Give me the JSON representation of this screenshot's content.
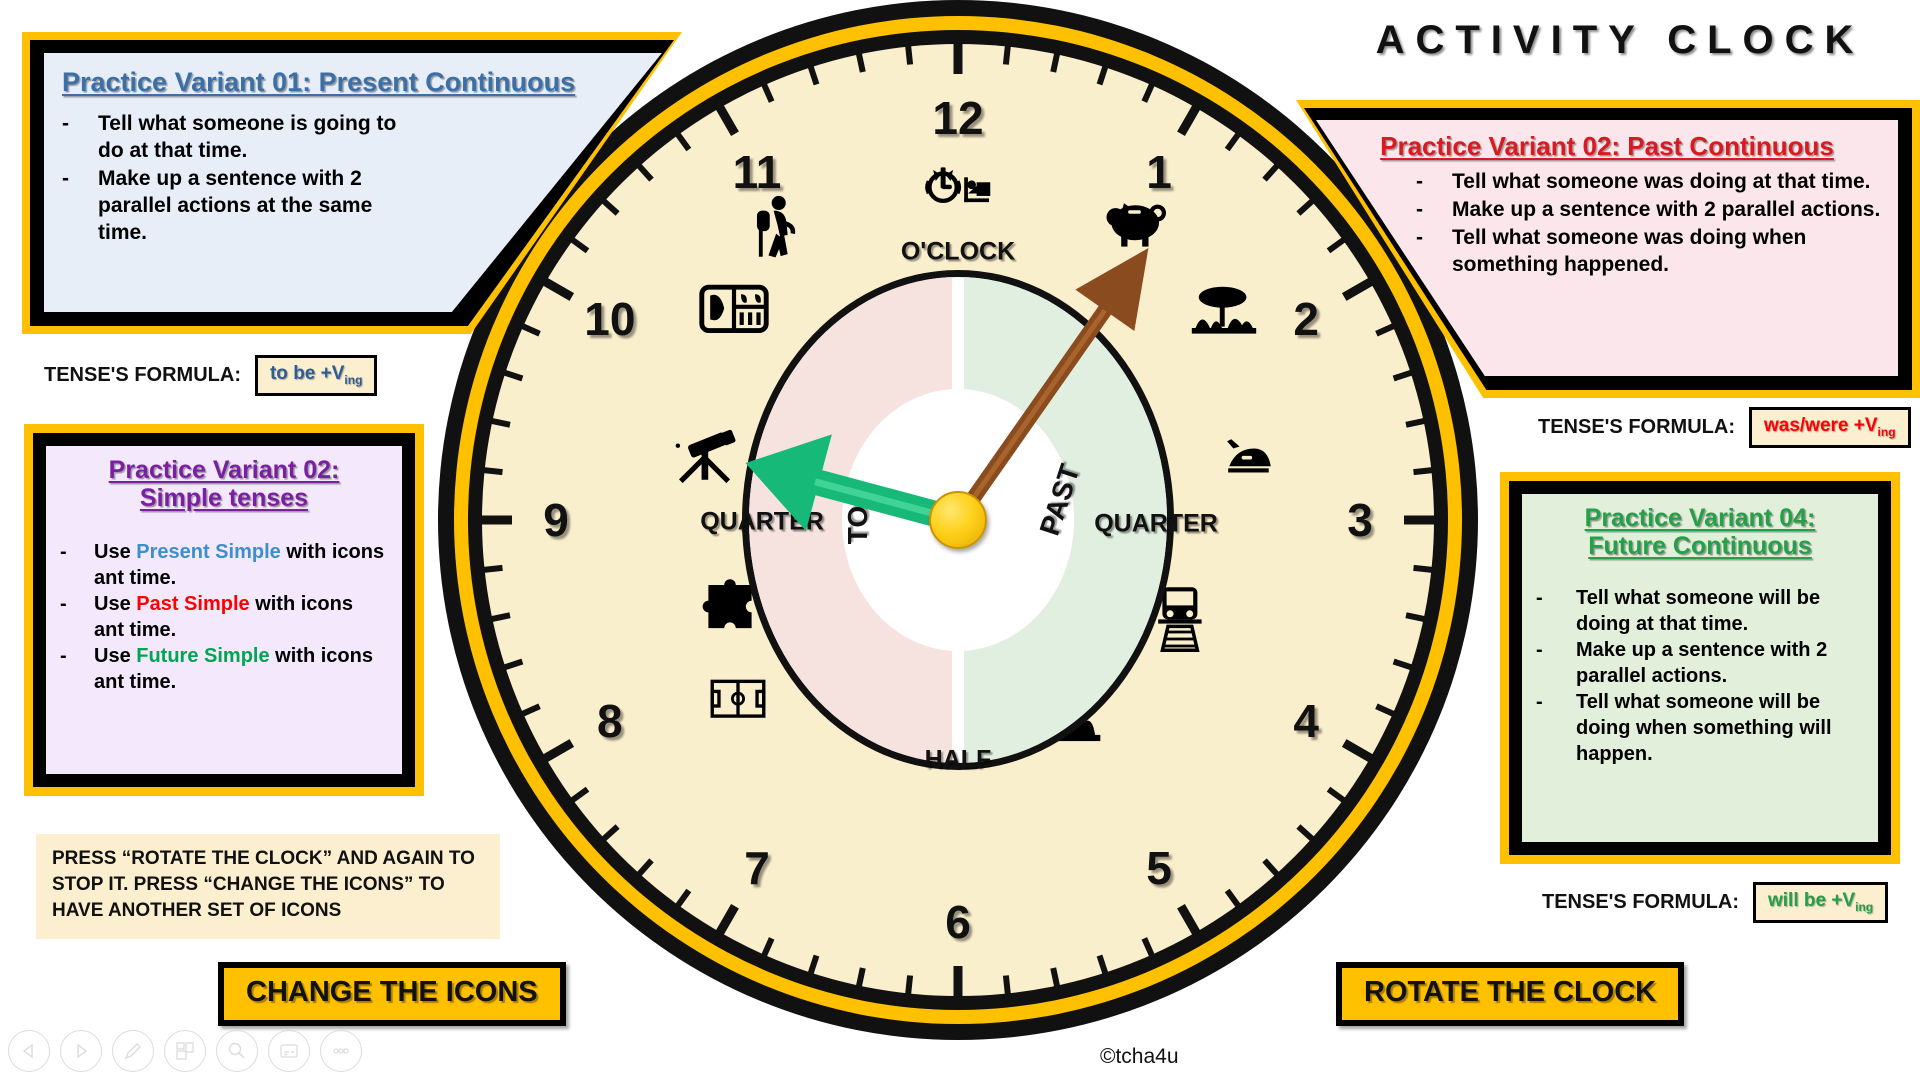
{
  "title": "ACTIVITY CLOCK",
  "copyright": "©tcha4u",
  "boxes": {
    "box1": {
      "heading": "Practice Variant 01: Present Continuous",
      "bullets": [
        "Tell what someone is going to do at that time.",
        "Make up a sentence with 2 parallel actions at the same time."
      ],
      "color": "#3B6FA8",
      "bg": "#E8EEF7"
    },
    "box2": {
      "heading_line1": "Practice Variant 02:",
      "heading_line2": "Simple tenses",
      "bullets": [
        {
          "pre": "Use ",
          "hl": "Present Simple",
          "post": " with icons ant time.",
          "hl_color": "#3B8FCB"
        },
        {
          "pre": "Use ",
          "hl": "Past Simple",
          "post": " with icons ant time.",
          "hl_color": "#FF0000"
        },
        {
          "pre": "Use ",
          "hl": "Future Simple",
          "post": " with icons ant time.",
          "hl_color": "#00A651"
        }
      ],
      "color": "#7B1FA2",
      "bg": "#F4E8FC"
    },
    "box3": {
      "heading": "Practice Variant 02: Past Continuous",
      "bullets": [
        "Tell what someone was doing at that time.",
        "Make up a sentence with 2 parallel actions.",
        "Tell what someone was doing when something happened."
      ],
      "color": "#D91A20",
      "bg": "#FBE7EB"
    },
    "box4": {
      "heading_line1": "Practice Variant 04:",
      "heading_line2": "Future Continuous",
      "bullets": [
        "Tell what someone will be doing at that time.",
        "Make up a sentence with 2 parallel actions.",
        "Tell what someone will be doing when something will happen."
      ],
      "color": "#23A048",
      "bg": "#E2EFDA"
    }
  },
  "formulas": [
    {
      "label": "TENSE'S FORMULA:",
      "value_main": "to be +V",
      "value_sub": "ing",
      "color": "#2E5C96"
    },
    {
      "label": "TENSE'S FORMULA:",
      "value_main": "was/were +V",
      "value_sub": "ing",
      "color": "#FF0000"
    },
    {
      "label": "TENSE'S FORMULA:",
      "value_main": "will be +V",
      "value_sub": "ing",
      "color": "#23A048"
    }
  ],
  "note": "PRESS “ROTATE THE CLOCK” AND AGAIN TO STOP IT. PRESS “CHANGE THE ICONS” TO HAVE ANOTHER SET OF ICONS",
  "buttons": {
    "change_icons": "CHANGE THE ICONS",
    "rotate_clock": "ROTATE THE CLOCK"
  },
  "clock": {
    "numerals": [
      "12",
      "1",
      "2",
      "3",
      "4",
      "5",
      "6",
      "7",
      "8",
      "9",
      "10",
      "11"
    ],
    "dial_labels": {
      "top": "O'CLOCK",
      "bottom": "HALF",
      "left": "QUARTER",
      "right": "QUARTER",
      "left_inner": "TO",
      "right_inner": "PAST"
    },
    "hands": {
      "minute_hand_color": "#17B978",
      "hour_hand_color": "#8A4B1E",
      "minute_hand_angle_deg": 105,
      "hour_hand_angle_deg": 215,
      "hub_color": "#FFD11A"
    },
    "icons": [
      {
        "position": "12",
        "name": "alarm-clock-and-bed-icon"
      },
      {
        "position": "1",
        "name": "piggy-bank-icon"
      },
      {
        "position": "2",
        "name": "park-tree-icon"
      },
      {
        "position": "3",
        "name": "clothes-iron-icon"
      },
      {
        "position": "4",
        "name": "train-icon"
      },
      {
        "position": "5",
        "name": "washing-hands-icon"
      },
      {
        "position": "6",
        "name": "photo-cards-icon"
      },
      {
        "position": "8",
        "name": "football-pitch-icon"
      },
      {
        "position": "8b",
        "name": "jigsaw-puzzle-icon"
      },
      {
        "position": "9",
        "name": "telescope-icon"
      },
      {
        "position": "10",
        "name": "food-tray-icon"
      },
      {
        "position": "11",
        "name": "hiker-icon"
      }
    ]
  },
  "taskbar": [
    {
      "name": "previous-slide-button",
      "glyph": "prev"
    },
    {
      "name": "next-slide-button",
      "glyph": "next"
    },
    {
      "name": "pen-tool-button",
      "glyph": "pen"
    },
    {
      "name": "all-slides-button",
      "glyph": "grid"
    },
    {
      "name": "zoom-button",
      "glyph": "magnifier"
    },
    {
      "name": "subtitles-button",
      "glyph": "subtitles"
    },
    {
      "name": "more-options-button",
      "glyph": "ellipsis"
    }
  ],
  "colors": {
    "gold": "#FFC000",
    "face": "#FAEFCD",
    "ink": "#111111"
  }
}
